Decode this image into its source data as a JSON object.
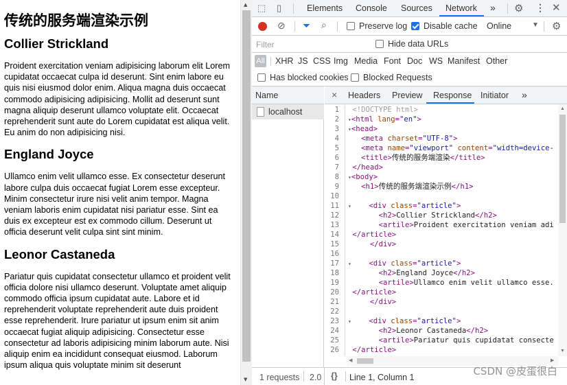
{
  "page": {
    "heading": "传统的服务端渲染示例",
    "articles": [
      {
        "title": "Collier Strickland",
        "body": "Proident exercitation veniam adipisicing laborum elit Lorem cupidatat occaecat culpa id deserunt. Sint enim labore eu quis nisi eiusmod dolor enim. Aliqua magna duis occaecat commodo adipisicing adipisicing. Mollit ad deserunt sunt magna aliquip deserunt ullamco voluptate elit. Occaecat reprehenderit sunt aute do Lorem cupidatat est aliqua velit. Eu anim do non adipisicing nisi."
      },
      {
        "title": "England Joyce",
        "body": "Ullamco enim velit ullamco esse. Ex consectetur deserunt labore culpa duis occaecat fugiat Lorem esse excepteur. Minim consectetur irure nisi velit anim tempor. Magna veniam laboris enim cupidatat nisi pariatur esse. Sint ea duis ex excepteur est ex commodo cillum. Deserunt ut officia deserunt velit culpa sint sint minim."
      },
      {
        "title": "Leonor Castaneda",
        "body": "Pariatur quis cupidatat consectetur ullamco et proident velit officia dolore nisi ullamco deserunt. Voluptate amet aliquip commodo officia ipsum cupidatat aute. Labore et id reprehenderit voluptate reprehenderit aute duis proident esse reprehenderit. Irure pariatur ut ipsum enim sit anim occaecat fugiat aliquip adipisicing. Consectetur esse consectetur ad laboris adipisicing minim laborum aute. Nisi aliquip enim ea incididunt consequat eiusmod. Laborum ipsum aliqua quis voluptate minim sit deserunt"
      }
    ]
  },
  "devtools": {
    "tabs": [
      "Elements",
      "Console",
      "Sources",
      "Network"
    ],
    "more_tabs_glyph": "»",
    "active_tab": "Network",
    "toolbar": {
      "preserve_log": "Preserve log",
      "preserve_log_checked": false,
      "disable_cache": "Disable cache",
      "disable_cache_checked": true,
      "throttle": "Online"
    },
    "filter": {
      "placeholder": "Filter",
      "hide_data_urls": "Hide data URLs"
    },
    "types": [
      "All",
      "XHR",
      "JS",
      "CSS",
      "Img",
      "Media",
      "Font",
      "Doc",
      "WS",
      "Manifest",
      "Other"
    ],
    "blocked": {
      "has_blocked_cookies": "Has blocked cookies",
      "blocked_requests": "Blocked Requests"
    },
    "request_list": {
      "header": "Name",
      "items": [
        "localhost"
      ]
    },
    "detail_tabs": [
      "Headers",
      "Preview",
      "Response",
      "Initiator"
    ],
    "close_glyph": "×",
    "active_detail_tab": "Response",
    "status": {
      "requests": "1 requests",
      "transferred": "2.0",
      "braces": "{}",
      "cursor": "Line 1, Column 1"
    },
    "colors": {
      "accent": "#1a73e8",
      "record": "#d93025",
      "tag": "#881280",
      "attribute": "#994500",
      "value": "#1a1aa6"
    }
  },
  "code_lines": [
    "<!DOCTYPE html>",
    "<html lang=\"en\">",
    "<head>",
    "  <meta charset=\"UTF-8\">",
    "  <meta name=\"viewport\" content=\"width=device-",
    "  <title>传统的服务端渲染</title>",
    "</head>",
    "<body>",
    "  <h1>传统的服务端渲染示例</h1>",
    "",
    "    <div class=\"article\">",
    "      <h2>Collier Strickland</h2>",
    "      <artile>Proident exercitation veniam adi",
    "</article>",
    "    </div>",
    "",
    "    <div class=\"article\">",
    "      <h2>England Joyce</h2>",
    "      <artile>Ullamco enim velit ullamco esse.",
    "</article>",
    "    </div>",
    "",
    "    <div class=\"article\">",
    "      <h2>Leonor Castaneda</h2>",
    "      <artile>Pariatur quis cupidatat consecte",
    "</article>",
    ""
  ],
  "watermark": "CSDN @皮蛋很白"
}
